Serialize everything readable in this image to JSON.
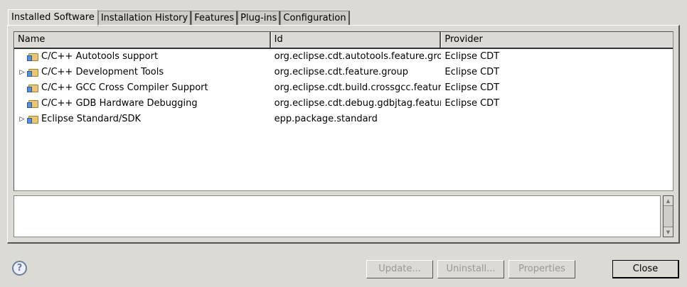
{
  "tabs": [
    "Installed Software",
    "Installation History",
    "Features",
    "Plug-ins",
    "Configuration"
  ],
  "columns": {
    "name": "Name",
    "id": "Id",
    "provider": "Provider"
  },
  "rows": [
    {
      "name": "C/C++ Autotools support",
      "id": "org.eclipse.cdt.autotools.feature.group",
      "provider": "Eclipse CDT",
      "expander": ""
    },
    {
      "name": "C/C++ Development Tools",
      "id": "org.eclipse.cdt.feature.group",
      "provider": "Eclipse CDT",
      "expander": "▷"
    },
    {
      "name": "C/C++ GCC Cross Compiler Support",
      "id": "org.eclipse.cdt.build.crossgcc.feature.group",
      "provider": "Eclipse CDT",
      "expander": ""
    },
    {
      "name": "C/C++ GDB Hardware Debugging",
      "id": "org.eclipse.cdt.debug.gdbjtag.feature.group",
      "provider": "Eclipse CDT",
      "expander": ""
    },
    {
      "name": "Eclipse Standard/SDK",
      "id": "epp.package.standard",
      "provider": "",
      "expander": "▷"
    }
  ],
  "buttons": {
    "update": "Update...",
    "uninstall": "Uninstall...",
    "properties": "Properties",
    "close": "Close"
  },
  "help": "?"
}
